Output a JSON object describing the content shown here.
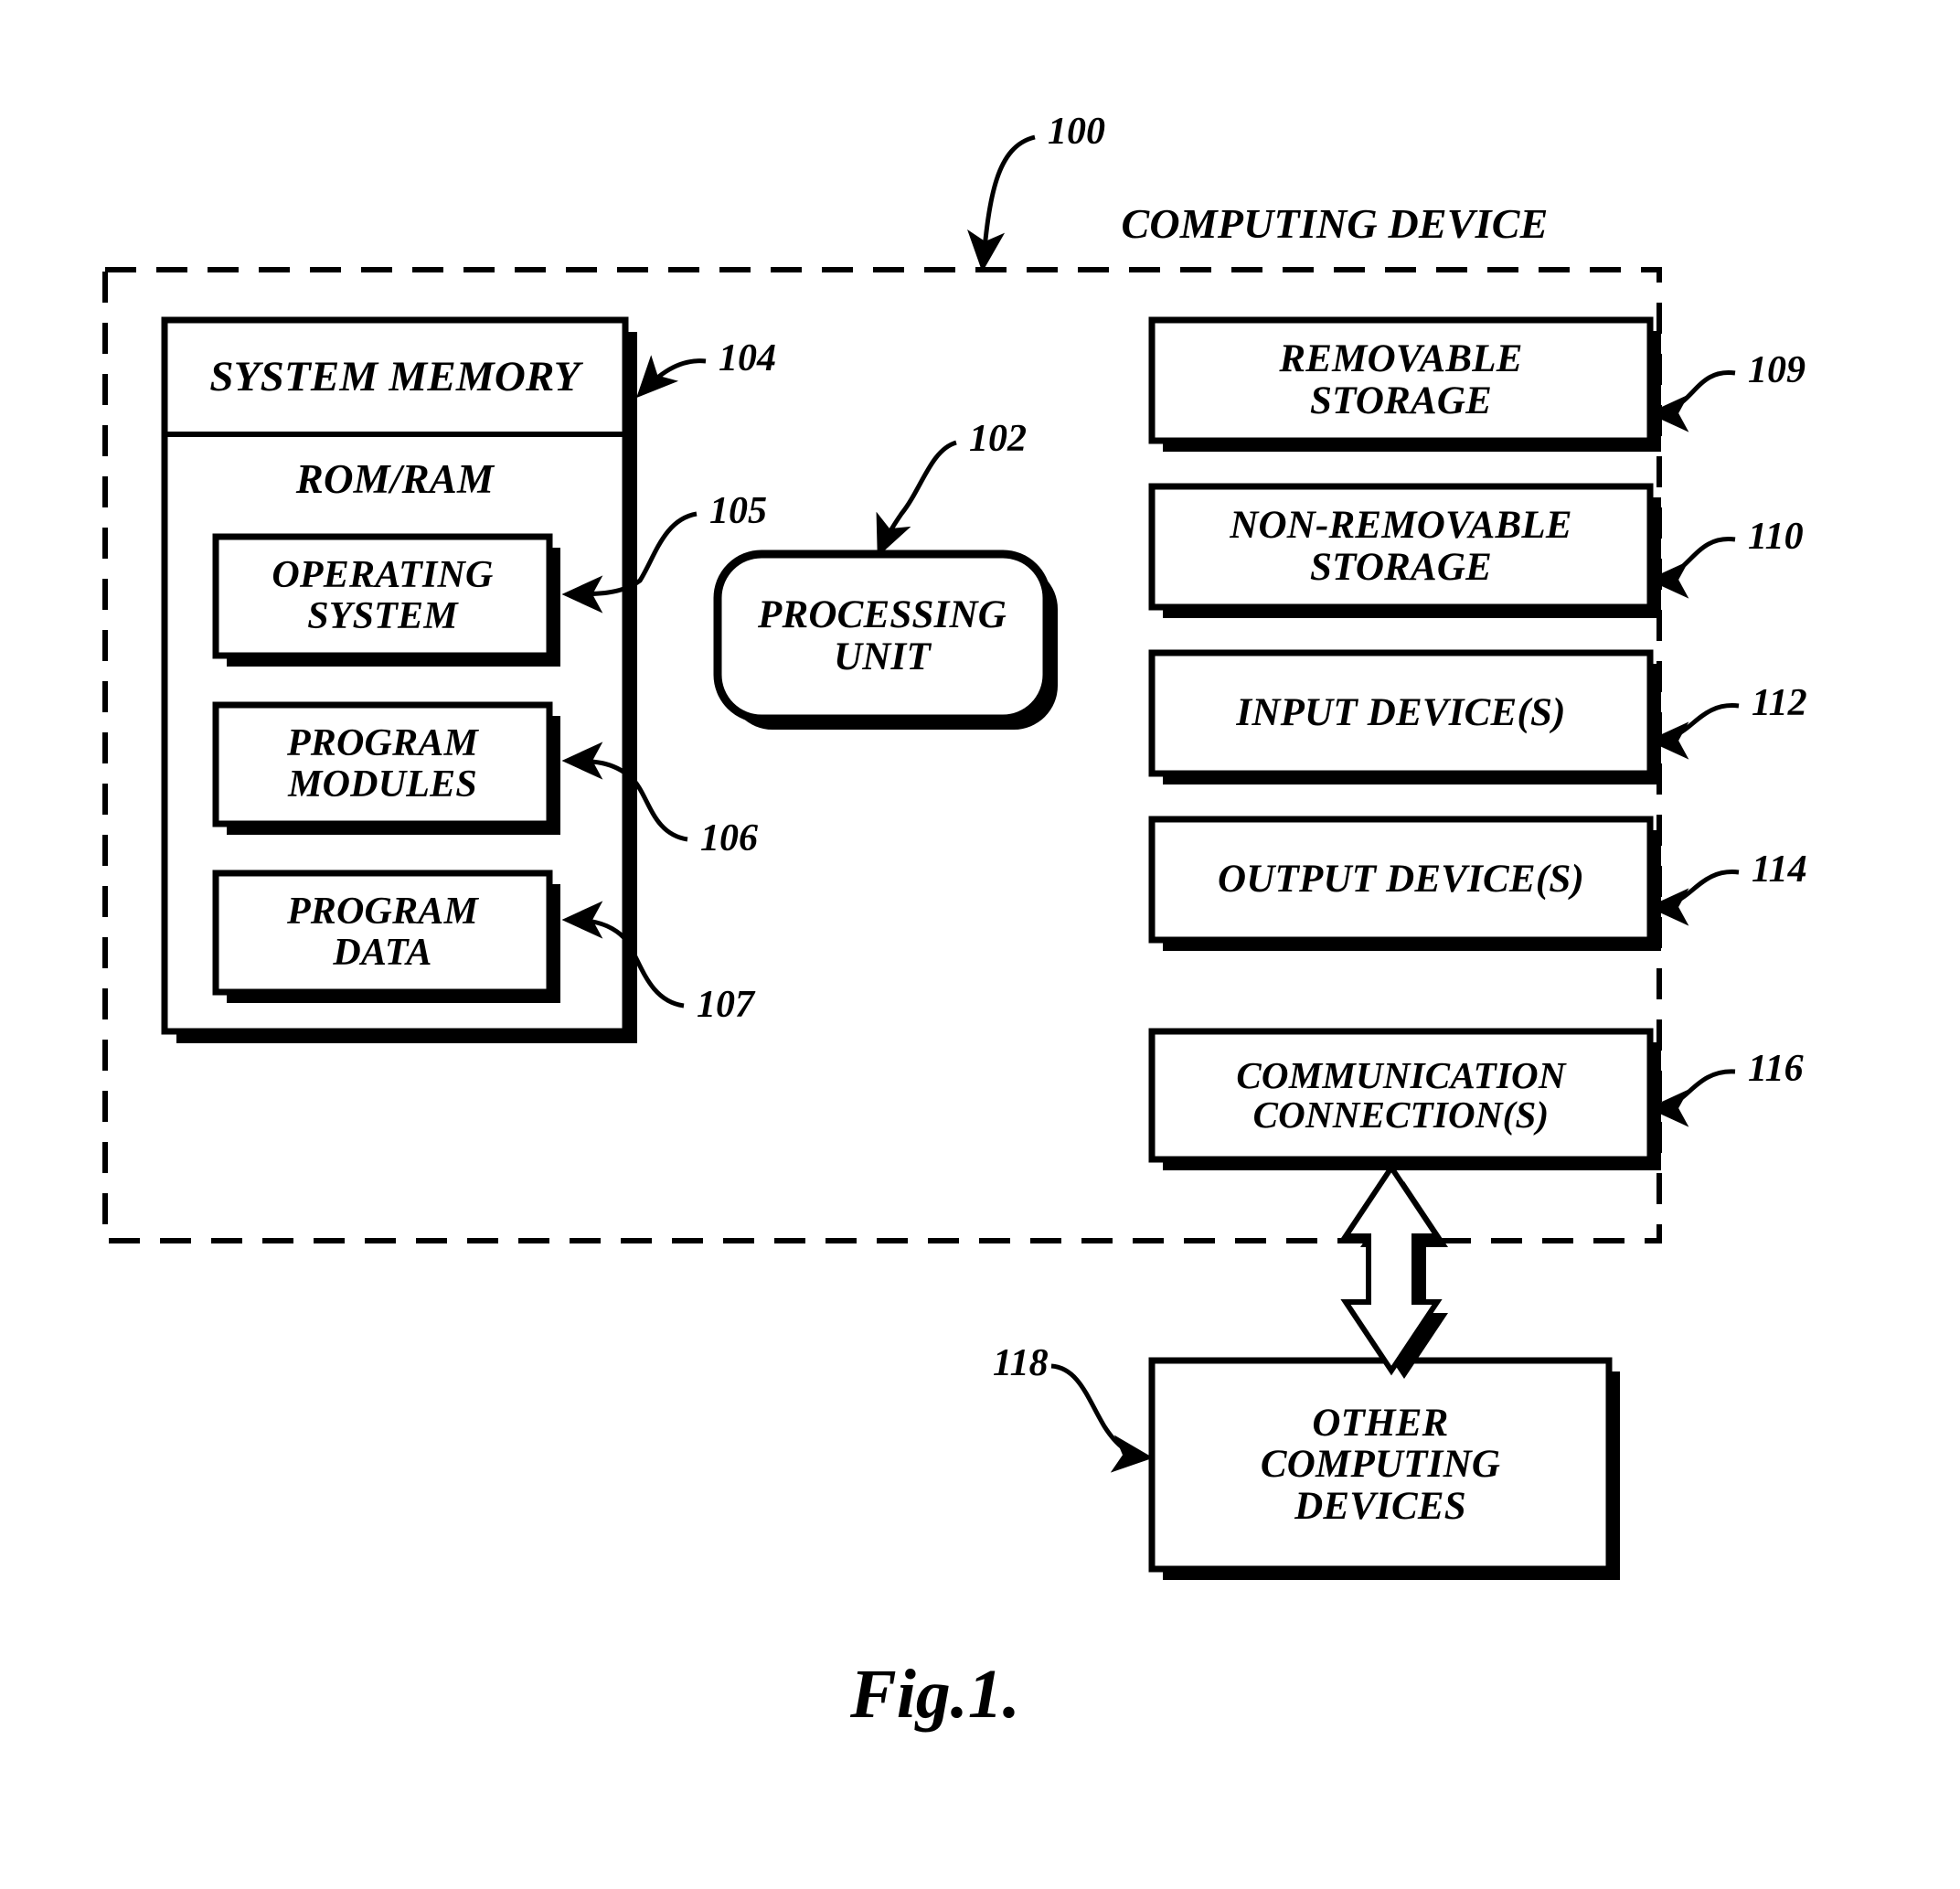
{
  "figure": {
    "caption": "Fig.1.",
    "container_title": "COMPUTING DEVICE",
    "container_ref": "100"
  },
  "chart_data": {
    "type": "diagram",
    "title": "COMPUTING DEVICE",
    "nodes": [
      {
        "id": "100",
        "label": "COMPUTING DEVICE",
        "shape": "dashed-container"
      },
      {
        "id": "104",
        "label": "SYSTEM MEMORY",
        "shape": "rect-shadow"
      },
      {
        "id": "105",
        "label": "OPERATING SYSTEM",
        "shape": "rect-shadow"
      },
      {
        "id": "106",
        "label": "PROGRAM MODULES",
        "shape": "rect-shadow"
      },
      {
        "id": "107",
        "label": "PROGRAM DATA",
        "shape": "rect-shadow"
      },
      {
        "id": "102",
        "label": "PROCESSING UNIT",
        "shape": "rounded-rect-shadow"
      },
      {
        "id": "109",
        "label": "REMOVABLE STORAGE",
        "shape": "rect-shadow"
      },
      {
        "id": "110",
        "label": "NON-REMOVABLE STORAGE",
        "shape": "rect-shadow"
      },
      {
        "id": "112",
        "label": "INPUT DEVICE(S)",
        "shape": "rect-shadow"
      },
      {
        "id": "114",
        "label": "OUTPUT DEVICE(S)",
        "shape": "rect-shadow"
      },
      {
        "id": "116",
        "label": "COMMUNICATION CONNECTION(S)",
        "shape": "rect-shadow"
      },
      {
        "id": "118",
        "label": "OTHER COMPUTING DEVICES",
        "shape": "rect-shadow"
      }
    ],
    "edges": [
      {
        "from": "116",
        "to": "118",
        "style": "double-headed-block-arrow"
      }
    ]
  },
  "boxes": {
    "system_memory": {
      "title": "SYSTEM MEMORY",
      "subtitle": "ROM/RAM",
      "ref": "104",
      "items": [
        {
          "label": "OPERATING\nSYSTEM",
          "ref": "105"
        },
        {
          "label": "PROGRAM\nMODULES",
          "ref": "106"
        },
        {
          "label": "PROGRAM\nDATA",
          "ref": "107"
        }
      ]
    },
    "processing_unit": {
      "label": "PROCESSING\nUNIT",
      "ref": "102"
    },
    "peripherals": [
      {
        "label": "REMOVABLE\nSTORAGE",
        "ref": "109"
      },
      {
        "label": "NON-REMOVABLE\nSTORAGE",
        "ref": "110"
      },
      {
        "label": "INPUT DEVICE(S)",
        "ref": "112"
      },
      {
        "label": "OUTPUT DEVICE(S)",
        "ref": "114"
      },
      {
        "label": "COMMUNICATION\nCONNECTION(S)",
        "ref": "116"
      }
    ],
    "other_devices": {
      "label": "OTHER\nCOMPUTING\nDEVICES",
      "ref": "118"
    }
  },
  "colors": {
    "ink": "#000000",
    "paper": "#ffffff"
  }
}
